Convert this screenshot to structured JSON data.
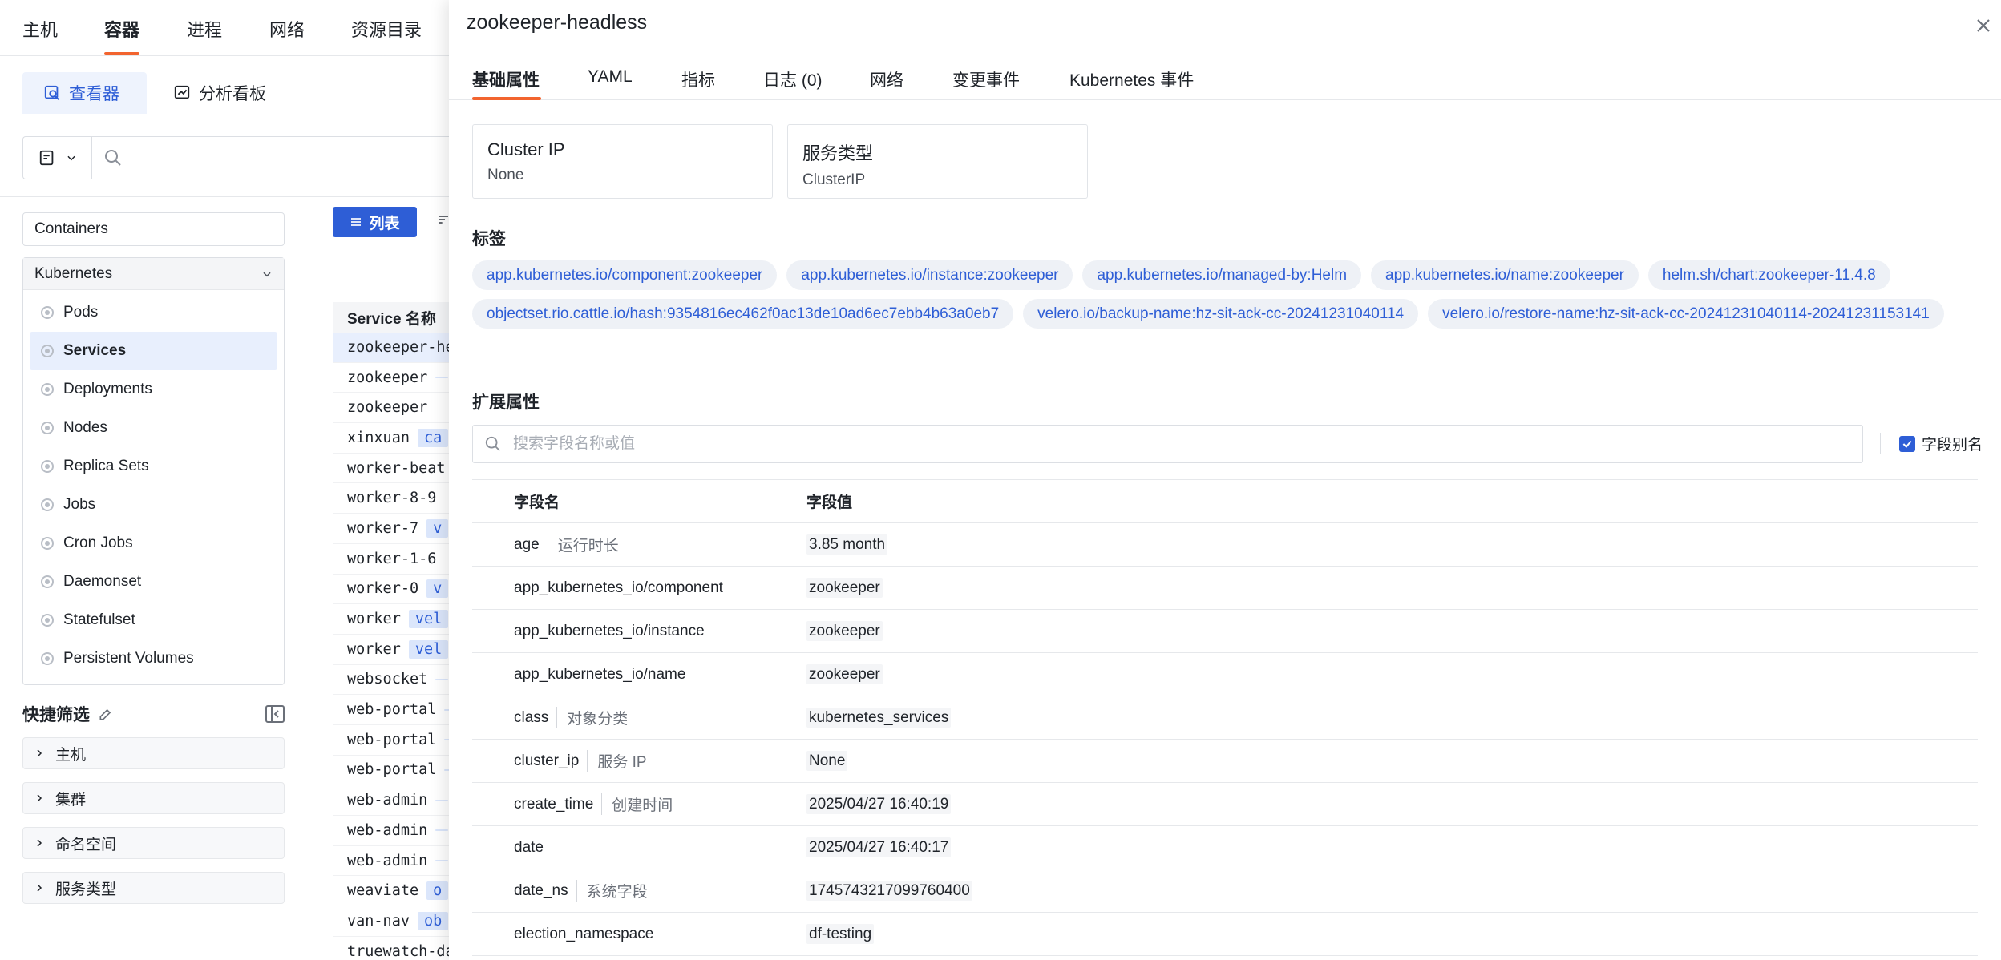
{
  "topnav": {
    "items": [
      "主机",
      "容器",
      "进程",
      "网络",
      "资源目录"
    ],
    "active_index": 1
  },
  "subtabs": {
    "viewer": "查看器",
    "dashboard": "分析看板"
  },
  "left": {
    "containers": "Containers",
    "kubernetes": "Kubernetes",
    "k8s_items": [
      "Pods",
      "Services",
      "Deployments",
      "Nodes",
      "Replica Sets",
      "Jobs",
      "Cron Jobs",
      "Daemonset",
      "Statefulset",
      "Persistent Volumes"
    ],
    "active_k8s": "Services",
    "quick_filter_title": "快捷筛选",
    "quick_filters": [
      "主机",
      "集群",
      "命名空间",
      "服务类型"
    ]
  },
  "list": {
    "list_button": "列表",
    "column_header": "Service 名称",
    "rows": [
      {
        "name": "zookeeper-he",
        "tag": ""
      },
      {
        "name": "zookeeper",
        "tag": " "
      },
      {
        "name": "zookeeper",
        "tag": ""
      },
      {
        "name": "xinxuan",
        "tag": "ca"
      },
      {
        "name": "worker-beat",
        "tag": ""
      },
      {
        "name": "worker-8-9",
        "tag": ""
      },
      {
        "name": "worker-7",
        "tag": "v"
      },
      {
        "name": "worker-1-6",
        "tag": ""
      },
      {
        "name": "worker-0",
        "tag": "v"
      },
      {
        "name": "worker",
        "tag": "vel"
      },
      {
        "name": "worker",
        "tag": "vel"
      },
      {
        "name": "websocket",
        "tag": " "
      },
      {
        "name": "web-portal",
        "tag": " "
      },
      {
        "name": "web-portal",
        "tag": " "
      },
      {
        "name": "web-portal",
        "tag": " "
      },
      {
        "name": "web-admin",
        "tag": " "
      },
      {
        "name": "web-admin",
        "tag": " "
      },
      {
        "name": "web-admin",
        "tag": " "
      },
      {
        "name": "weaviate",
        "tag": "o"
      },
      {
        "name": "van-nav",
        "tag": "ob"
      },
      {
        "name": "truewatch-da",
        "tag": ""
      }
    ]
  },
  "drawer": {
    "title": "zookeeper-headless",
    "tabs": [
      "基础属性",
      "YAML",
      "指标",
      "日志 (0)",
      "网络",
      "变更事件",
      "Kubernetes 事件"
    ],
    "cards": [
      {
        "label": "Cluster IP",
        "value": "None"
      },
      {
        "label": "服务类型",
        "value": "ClusterIP"
      }
    ],
    "labels_title": "标签",
    "labels": [
      "app.kubernetes.io/component:zookeeper",
      "app.kubernetes.io/instance:zookeeper",
      "app.kubernetes.io/managed-by:Helm",
      "app.kubernetes.io/name:zookeeper",
      "helm.sh/chart:zookeeper-11.4.8",
      "objectset.rio.cattle.io/hash:9354816ec462f0ac13de10ad6ec7ebb4b63a0eb7",
      "velero.io/backup-name:hz-sit-ack-cc-20241231040114",
      "velero.io/restore-name:hz-sit-ack-cc-20241231040114-20241231153141"
    ],
    "ext_title": "扩展属性",
    "search_placeholder": "搜索字段名称或值",
    "alias_checkbox": "字段别名",
    "table": {
      "col_name": "字段名",
      "col_value": "字段值",
      "rows": [
        {
          "name": "age",
          "alias": "运行时长",
          "value": "3.85 month"
        },
        {
          "name": "app_kubernetes_io/component",
          "alias": "",
          "value": "zookeeper"
        },
        {
          "name": "app_kubernetes_io/instance",
          "alias": "",
          "value": "zookeeper"
        },
        {
          "name": "app_kubernetes_io/name",
          "alias": "",
          "value": "zookeeper"
        },
        {
          "name": "class",
          "alias": "对象分类",
          "value": "kubernetes_services"
        },
        {
          "name": "cluster_ip",
          "alias": "服务 IP",
          "value": "None"
        },
        {
          "name": "create_time",
          "alias": "创建时间",
          "value": "2025/04/27 16:40:19"
        },
        {
          "name": "date",
          "alias": "",
          "value": "2025/04/27 16:40:17"
        },
        {
          "name": "date_ns",
          "alias": "系统字段",
          "value": "1745743217099760400"
        },
        {
          "name": "election_namespace",
          "alias": "",
          "value": "df-testing"
        }
      ]
    }
  }
}
